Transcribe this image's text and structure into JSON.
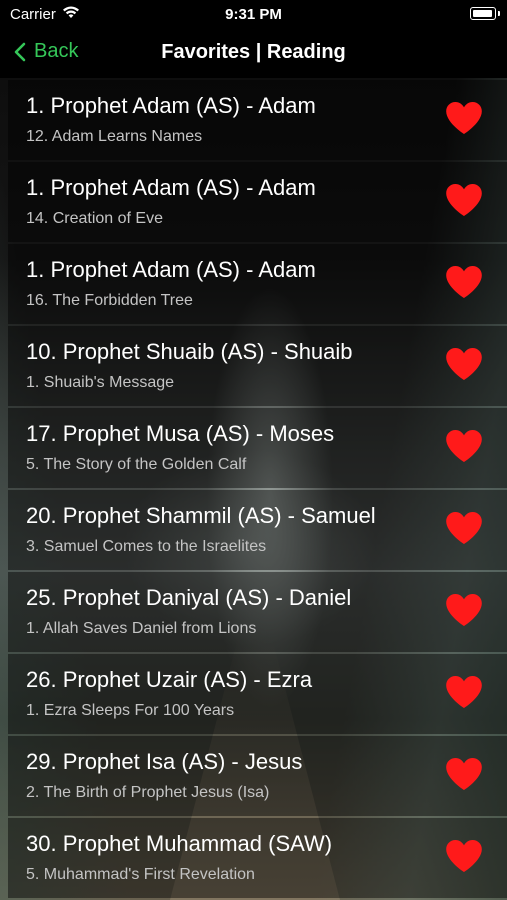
{
  "status_bar": {
    "carrier": "Carrier",
    "time": "9:31 PM"
  },
  "nav": {
    "back_label": "Back",
    "title": "Favorites | Reading"
  },
  "heart_color": "#ff1a1a",
  "accent_color": "#35c759",
  "items": [
    {
      "title": "1. Prophet Adam (AS) - Adam",
      "subtitle": "12. Adam Learns Names"
    },
    {
      "title": "1. Prophet Adam (AS) - Adam",
      "subtitle": "14. Creation of Eve"
    },
    {
      "title": "1. Prophet Adam (AS) - Adam",
      "subtitle": "16. The Forbidden Tree"
    },
    {
      "title": "10. Prophet Shuaib (AS) - Shuaib",
      "subtitle": "1. Shuaib's Message"
    },
    {
      "title": "17. Prophet Musa (AS) - Moses",
      "subtitle": "5. The Story of the Golden Calf"
    },
    {
      "title": "20. Prophet Shammil (AS) - Samuel",
      "subtitle": "3. Samuel Comes to the Israelites"
    },
    {
      "title": "25. Prophet Daniyal (AS) - Daniel",
      "subtitle": "1. Allah Saves Daniel from Lions"
    },
    {
      "title": "26. Prophet Uzair (AS) - Ezra",
      "subtitle": "1. Ezra Sleeps For 100 Years"
    },
    {
      "title": "29. Prophet Isa (AS) - Jesus",
      "subtitle": "2. The Birth of Prophet Jesus (Isa)"
    },
    {
      "title": "30. Prophet Muhammad (SAW)",
      "subtitle": "5. Muhammad's First Revelation"
    }
  ]
}
